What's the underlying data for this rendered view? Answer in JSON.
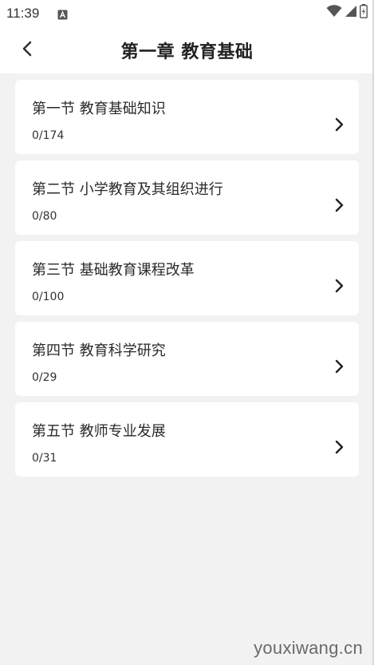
{
  "status_bar": {
    "time": "11:39",
    "icons": [
      "notification-a-icon",
      "wifi-icon",
      "signal-icon",
      "battery-icon"
    ]
  },
  "header": {
    "back_icon": "chevron-left-icon",
    "title": "第一章 教育基础"
  },
  "sections": [
    {
      "title": "第一节 教育基础知识",
      "progress": "0/174"
    },
    {
      "title": "第二节 小学教育及其组织进行",
      "progress": "0/80"
    },
    {
      "title": "第三节 基础教育课程改革",
      "progress": "0/100"
    },
    {
      "title": "第四节 教育科学研究",
      "progress": "0/29"
    },
    {
      "title": "第五节 教师专业发展",
      "progress": "0/31"
    }
  ],
  "watermark": "youxiwang.cn",
  "colors": {
    "background": "#f2f2f2",
    "card": "#ffffff",
    "text": "#222222"
  }
}
